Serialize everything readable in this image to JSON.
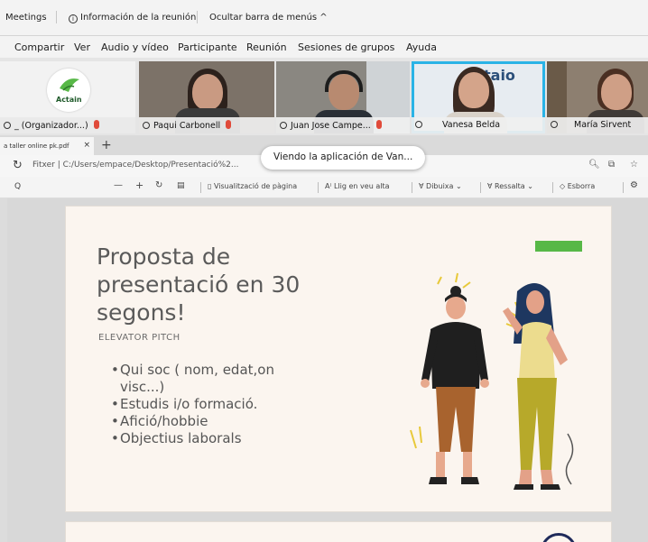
{
  "meeting_bar": {
    "meetings": "Meetings",
    "info": "Información de la reunión",
    "hide_menu": "Ocultar barra de menús ^"
  },
  "menu": {
    "items": [
      "Compartir",
      "Ver",
      "Audio y vídeo",
      "Participante",
      "Reunión",
      "Sesiones de grupos",
      "Ayuda"
    ]
  },
  "videos": {
    "logo_text": "Actain",
    "tiles": [
      {
        "name": "_ (Organizador...)"
      },
      {
        "name": "Paqui Carbonell"
      },
      {
        "name": "Juan Jose Campe..."
      },
      {
        "name": "Vanesa Belda",
        "background_text": "taio"
      },
      {
        "name": "María Sirvent"
      }
    ]
  },
  "tab": {
    "title": "a taller online pk.pdf",
    "close": "×",
    "new": "+"
  },
  "address": {
    "text": "Fitxer  |  C:/Users/empace/Desktop/Presentació%2..."
  },
  "tooltip": {
    "text": "Viendo la aplicación de Van..."
  },
  "pdf_toolbar": {
    "search": "Q",
    "minus": "—",
    "plus": "+",
    "view_label": "Visualització de pàgina",
    "read_aloud": "Llig en veu alta",
    "draw": "Dibuixa",
    "highlight": "Ressalta",
    "erase": "Esborra"
  },
  "slide": {
    "title_lines": [
      "Proposta de",
      "presentació en 30",
      "segons!"
    ],
    "subtitle": "ELEVATOR PITCH",
    "bullets": [
      "Qui soc ( nom, edat,on visc...)",
      "Estudis i/o formació.",
      "Afició/hobbie",
      "Objectius laborals"
    ]
  },
  "colors": {
    "accent_green": "#57b847",
    "active_speaker": "#2ab3e6",
    "slide_bg": "#fbf5ef",
    "mic_muted": "#e04a3a"
  },
  "icons": [
    "info-icon",
    "pin-icon",
    "mic-muted-icon",
    "reload-icon",
    "search-icon",
    "zoom-icon",
    "draw-icon",
    "highlight-icon",
    "eraser-icon"
  ]
}
